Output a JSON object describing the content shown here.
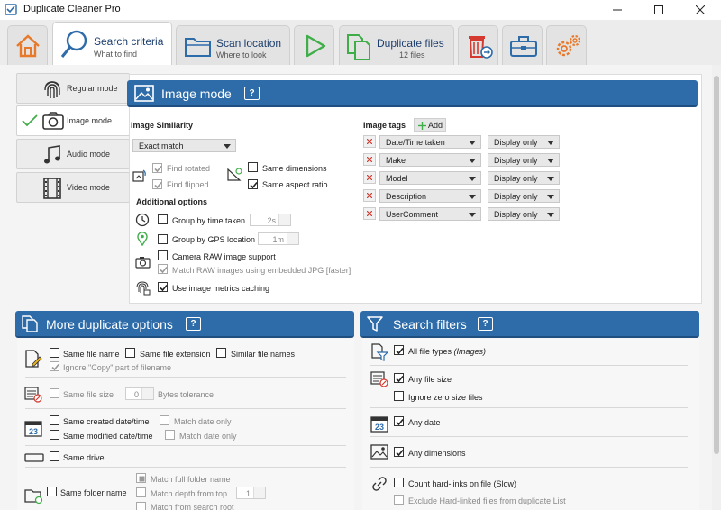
{
  "window": {
    "title": "Duplicate Cleaner Pro",
    "minimize": "—",
    "maximize": "☐",
    "close": "✕"
  },
  "tabs": {
    "home": {
      "icon": "home-icon"
    },
    "search_criteria": {
      "title": "Search criteria",
      "subtitle": "What to find",
      "icon": "search-icon"
    },
    "scan_location": {
      "title": "Scan location",
      "subtitle": "Where to look",
      "icon": "folder-icon"
    },
    "run": {
      "icon": "play-icon"
    },
    "duplicate_files": {
      "title": "Duplicate files",
      "subtitle": "12 files",
      "icon": "duplicate-files-icon"
    },
    "selection_assistant": {
      "icon": "trash-move-icon"
    },
    "toolbox": {
      "icon": "toolbox-icon"
    },
    "options": {
      "icon": "gears-icon"
    }
  },
  "modes": [
    {
      "label": "Regular mode",
      "icon": "fingerprint-icon",
      "active": false
    },
    {
      "label": "Image mode",
      "icon": "camera-icon",
      "active": true
    },
    {
      "label": "Audio mode",
      "icon": "music-note-icon",
      "active": false
    },
    {
      "label": "Video mode",
      "icon": "film-icon",
      "active": false
    }
  ],
  "image_mode": {
    "header": "Image mode",
    "help": "?",
    "similarity_label": "Image Similarity",
    "similarity_value": "Exact match",
    "find_rotated": "Find rotated",
    "find_flipped": "Find flipped",
    "same_dimensions": "Same dimensions",
    "same_aspect_ratio": "Same aspect ratio",
    "additional_options": "Additional options",
    "group_by_time": "Group by time taken",
    "group_by_time_value": "2s",
    "group_by_gps": "Group by GPS location",
    "group_by_gps_value": "1m",
    "camera_raw": "Camera RAW image support",
    "match_raw": "Match RAW images using embedded JPG [faster]",
    "metrics_caching": "Use image metrics caching",
    "image_tags_label": "Image tags",
    "add_button": "Add",
    "tags": [
      {
        "tag": "Date/Time taken",
        "display": "Display only"
      },
      {
        "tag": "Make",
        "display": "Display only"
      },
      {
        "tag": "Model",
        "display": "Display only"
      },
      {
        "tag": "Description",
        "display": "Display only"
      },
      {
        "tag": "UserComment",
        "display": "Display only"
      }
    ]
  },
  "more_options": {
    "header": "More duplicate options",
    "help": "?",
    "same_file_name": "Same file name",
    "same_file_extension": "Same file extension",
    "similar_file_names": "Similar file names",
    "ignore_copy": "Ignore \"Copy\" part of filename",
    "same_file_size": "Same file size",
    "bytes_tolerance_value": "0",
    "bytes_tolerance": "Bytes tolerance",
    "same_created": "Same created date/time",
    "match_date_only_1": "Match date only",
    "same_modified": "Same modified date/time",
    "match_date_only_2": "Match date only",
    "same_drive": "Same drive",
    "same_folder_name": "Same folder name",
    "match_full_folder": "Match full folder name",
    "match_depth": "Match depth from top",
    "match_depth_value": "1",
    "match_from_root": "Match from search root"
  },
  "search_filters": {
    "header": "Search filters",
    "help": "?",
    "all_file_types": "All file types",
    "all_file_types_suffix": "(Images)",
    "any_file_size": "Any file size",
    "ignore_zero": "Ignore zero size files",
    "any_date": "Any date",
    "any_dimensions": "Any dimensions",
    "count_hardlinks": "Count hard-links on file (Slow)",
    "exclude_hardlinked": "Exclude Hard-linked files from duplicate List"
  }
}
